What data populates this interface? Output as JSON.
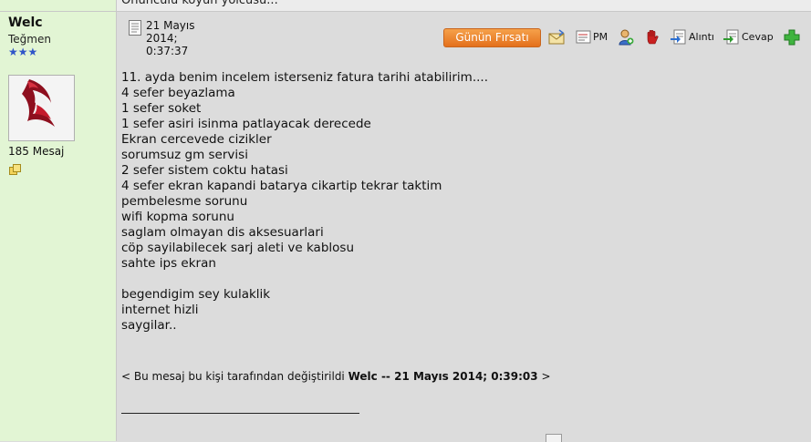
{
  "previous_post": {
    "tail_text": "Onunculu koyun yolcusu..."
  },
  "author": {
    "name": "Welc",
    "rank": "Teğmen",
    "stars": "★★★",
    "message_count": "185 Mesaj"
  },
  "post": {
    "date_line1": "21 Mayıs",
    "date_line2": "2014;",
    "date_line3": "0:37:37",
    "body": {
      "lines": [
        "11. ayda benim incelem isterseniz fatura tarihi atabilirim....",
        "4 sefer beyazlama",
        "1 sefer soket",
        "1 sefer asiri isinma patlayacak derecede",
        "Ekran cercevede cizikler",
        "sorumsuz gm servisi",
        "2 sefer sistem coktu hatasi",
        "4 sefer ekran kapandi batarya cikartip tekrar taktim",
        "pembelesme sorunu",
        "wifi kopma sorunu",
        "saglam olmayan dis aksesuarlari",
        "cöp sayilabilecek sarj aleti ve kablosu",
        "sahte ips ekran",
        "",
        "begendigim sey kulaklik",
        "internet hizli",
        "saygilar.."
      ]
    },
    "edit_note": {
      "prefix": "< Bu mesaj bu kişi tarafından değiştirildi ",
      "editor": "Welc",
      "separator": " -- ",
      "edit_date": "21 Mayıs 2014; 0:39:03",
      "suffix": " >"
    }
  },
  "toolbar": {
    "deal_button": "Günün Fırsatı",
    "pm_label": "PM",
    "quote_label": "Alıntı",
    "reply_label": "Cevap"
  },
  "colors": {
    "profile_bg": "#e2f5d4",
    "post_bg": "#dcdcdc",
    "deal_button": "#e4701c",
    "stars": "#2f55c8"
  },
  "icons": {
    "date": "document-icon",
    "email": "envelope-icon",
    "pm": "pm-icon",
    "add_buddy": "add-user-icon",
    "report": "red-hand-icon",
    "quote": "quote-icon",
    "reply": "reply-icon",
    "add": "green-plus-icon",
    "extra": "yellow-cards-icon"
  }
}
